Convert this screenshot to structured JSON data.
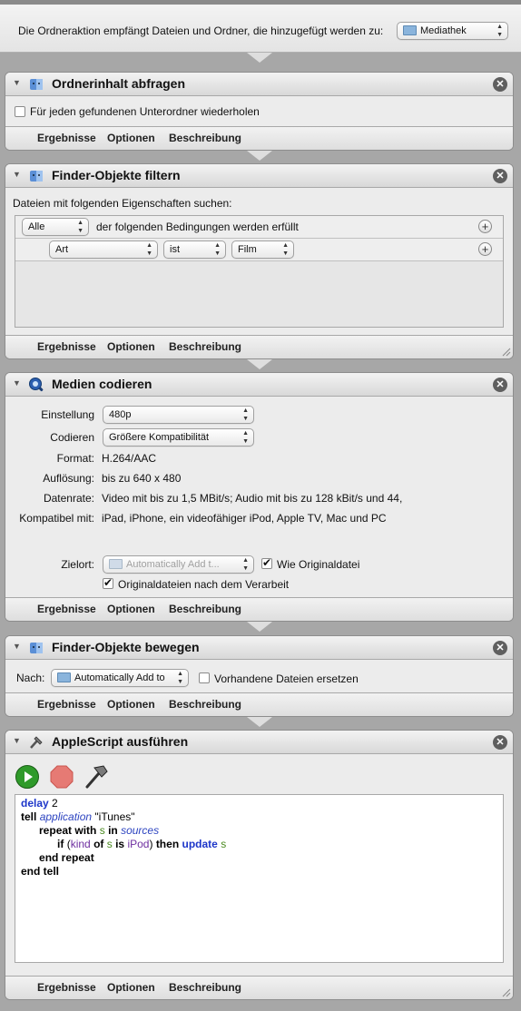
{
  "folder_action": {
    "text": "Die Ordneraktion empfängt Dateien und Ordner, die hinzugefügt werden zu:",
    "target": "Mediathek"
  },
  "footer_labels": [
    "Ergebnisse",
    "Optionen",
    "Beschreibung"
  ],
  "panels": {
    "p1": {
      "title": "Ordnerinhalt abfragen",
      "checkbox_label": "Für jeden gefundenen Unterordner wiederholen",
      "checked": false
    },
    "p2": {
      "title": "Finder-Objekte filtern",
      "desc": "Dateien mit folgenden Eigenschaften suchen:",
      "match_mode": "Alle",
      "match_text": "der folgenden Bedingungen werden erfüllt",
      "cond_field": "Art",
      "cond_op": "ist",
      "cond_value": "Film"
    },
    "p3": {
      "title": "Medien codieren",
      "einstellung_label": "Einstellung",
      "einstellung_value": "480p",
      "codieren_label": "Codieren",
      "codieren_value": "Größere Kompatibilität",
      "format_label": "Format:",
      "format_value": "H.264/AAC",
      "aufl_label": "Auflösung:",
      "aufl_value": "bis zu 640 x 480",
      "datenrate_label": "Datenrate:",
      "datenrate_value": "Video mit bis zu 1,5 MBit/s; Audio mit bis zu 128 kBit/s und 44,",
      "kompat_label": "Kompatibel mit:",
      "kompat_value": "iPad, iPhone, ein videofähiger iPod, Apple TV, Mac und PC",
      "zielort_label": "Zielort:",
      "zielort_value": "Automatically Add t...",
      "wie_original_label": "Wie Originaldatei",
      "wie_original_checked": true,
      "orig_label": "Originaldateien nach dem Verarbeit",
      "orig_checked": true
    },
    "p4": {
      "title": "Finder-Objekte bewegen",
      "nach_label": "Nach:",
      "nach_value": "Automatically Add to",
      "ersetzen_label": "Vorhandene Dateien ersetzen",
      "ersetzen_checked": false
    },
    "p5": {
      "title": "AppleScript ausführen",
      "code": {
        "l1_kw": "delay",
        "l1_num": "2",
        "l2_kw": "tell",
        "l2_app": "application",
        "l2_str": "\"iTunes\"",
        "l3_kw": "repeat with",
        "l3_var": "s",
        "l3_in": "in",
        "l3_src": "sources",
        "l4_if": "if",
        "l4_open": "(",
        "l4_kind": "kind",
        "l4_of": "of",
        "l4_s": "s",
        "l4_is": "is",
        "l4_ipod": "iPod",
        "l4_close": ")",
        "l4_then": "then",
        "l4_update": "update",
        "l4_s2": "s",
        "l5": "end repeat",
        "l6": "end tell"
      }
    }
  },
  "colors": {
    "keyword": "#1d36c9",
    "application": "#2d44c0",
    "variable": "#4a8a1f",
    "property": "#6e2fa0"
  },
  "icons": [
    "finder-action-icon",
    "quicktime-icon",
    "applescript-icon",
    "run-icon",
    "stop-icon",
    "compile-hammer-icon",
    "folder-icon",
    "close-icon",
    "disclosure-triangle-icon",
    "add-icon",
    "resize-grip-icon"
  ]
}
